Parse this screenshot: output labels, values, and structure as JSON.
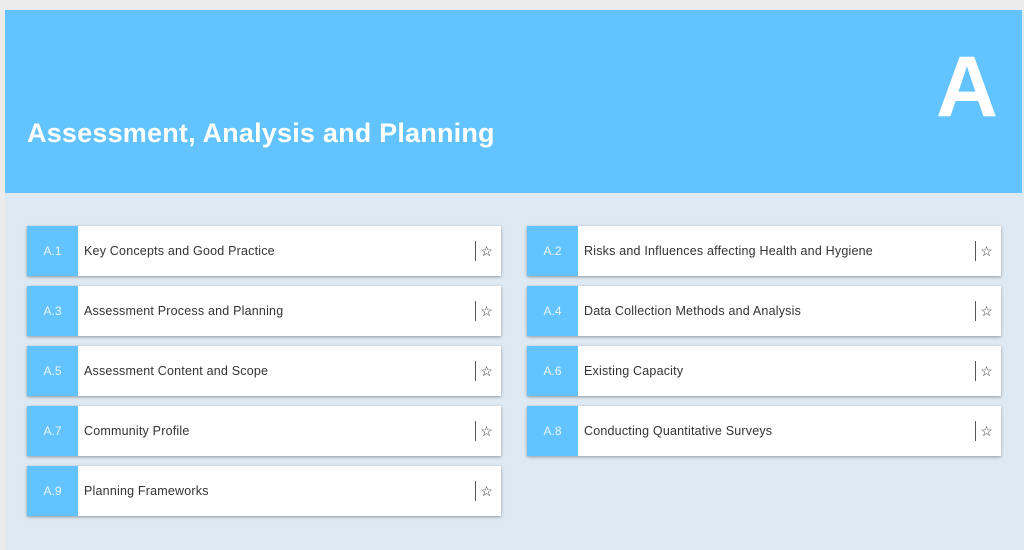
{
  "header": {
    "title": "Assessment, Analysis and Planning",
    "letter": "A"
  },
  "icons": {
    "bookmark": "star-outline-icon"
  },
  "colors": {
    "accent": "#62c3fe",
    "background": "#dde9f3"
  },
  "items": [
    {
      "num": "A.1",
      "label": "Key Concepts and Good Practice"
    },
    {
      "num": "A.2",
      "label": "Risks and Influences affecting Health and Hygiene"
    },
    {
      "num": "A.3",
      "label": "Assessment Process and Planning"
    },
    {
      "num": "A.4",
      "label": "Data Collection Methods and Analysis"
    },
    {
      "num": "A.5",
      "label": "Assessment Content and Scope"
    },
    {
      "num": "A.6",
      "label": "Existing Capacity"
    },
    {
      "num": "A.7",
      "label": "Community Profile"
    },
    {
      "num": "A.8",
      "label": "Conducting Quantitative Surveys"
    },
    {
      "num": "A.9",
      "label": "Planning Frameworks"
    }
  ]
}
